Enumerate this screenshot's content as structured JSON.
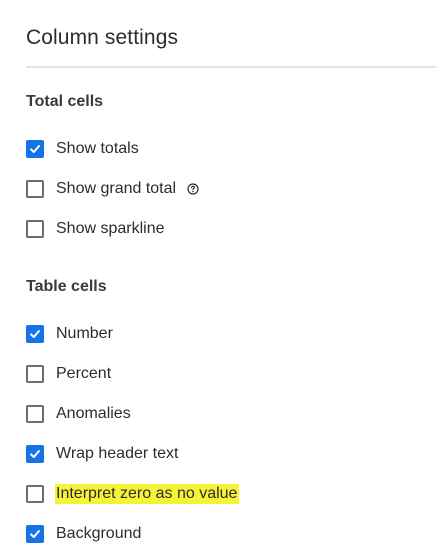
{
  "panel": {
    "title": "Column settings"
  },
  "sections": {
    "total_cells": {
      "heading": "Total cells",
      "items": [
        {
          "label": "Show totals",
          "checked": true
        },
        {
          "label": "Show grand total",
          "checked": false,
          "info_icon": "info-icon"
        },
        {
          "label": "Show sparkline",
          "checked": false
        }
      ]
    },
    "table_cells": {
      "heading": "Table cells",
      "items": [
        {
          "label": "Number",
          "checked": true
        },
        {
          "label": "Percent",
          "checked": false
        },
        {
          "label": "Anomalies",
          "checked": false
        },
        {
          "label": "Wrap header text",
          "checked": true
        },
        {
          "label": "Interpret zero as no value",
          "checked": false,
          "highlighted": true
        },
        {
          "label": "Background",
          "checked": true
        }
      ]
    }
  },
  "colors": {
    "accent": "#1473e6",
    "highlight": "#f6f337",
    "text": "#2c2c2c",
    "divider": "#e3e3e3"
  }
}
